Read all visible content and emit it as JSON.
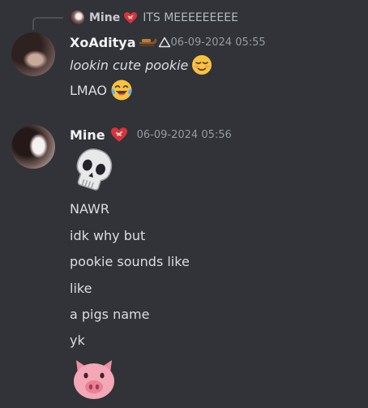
{
  "reply": {
    "author": "Mine",
    "text": "ITS MEEEEEEEEE"
  },
  "messages": [
    {
      "author": "XoAditya",
      "timestamp": "06-09-2024 05:55",
      "lines": [
        "lookin cute pookie",
        "LMAO"
      ]
    },
    {
      "author": "Mine",
      "timestamp": "06-09-2024 05:56",
      "lines": [
        "NAWR",
        "idk why but",
        "pookie sounds like",
        "like",
        "a pigs name",
        "yk"
      ]
    }
  ],
  "icons": {
    "reply_heart": "mending-heart-icon",
    "author_heart": "mending-heart-icon",
    "role_badge": "sled-icon",
    "role_badge_2": "triangle-icon",
    "emoji_1": "relieved-face-icon",
    "emoji_2": "tears-of-joy-icon",
    "emoji_3": "skull-icon",
    "emoji_4": "pig-face-icon"
  },
  "colors": {
    "background": "#313338",
    "username": "#f2f3f5",
    "message_text": "#dbdee1",
    "timestamp": "#949ba4",
    "heart": "#d6343f",
    "pig": "#f4a7b6"
  }
}
